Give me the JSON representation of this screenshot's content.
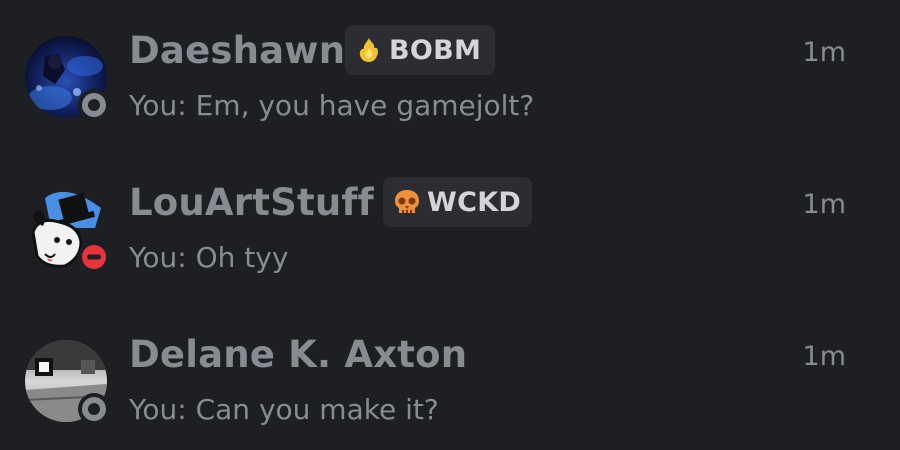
{
  "conversations": [
    {
      "name": "Daeshawn",
      "tag": {
        "label": "BOBM",
        "icon": "flame-icon",
        "color": "#f2c12e"
      },
      "preview": "You: Em, you have gamejolt?",
      "time": "1m",
      "status": "offline"
    },
    {
      "name": "LouArtStuff",
      "tag": {
        "label": "WCKD",
        "icon": "skull-icon",
        "color": "#f0903a"
      },
      "preview": "You: Oh tyy",
      "time": "1m",
      "status": "do-not-disturb"
    },
    {
      "name": "Delane K. Axton",
      "tag": null,
      "preview": "You: Can you make it?",
      "time": "1m",
      "status": "offline"
    }
  ],
  "colors": {
    "background": "#1e1f23",
    "text_muted": "#898b92",
    "tag_background": "#2c2d32",
    "dnd_red": "#e8333f"
  }
}
